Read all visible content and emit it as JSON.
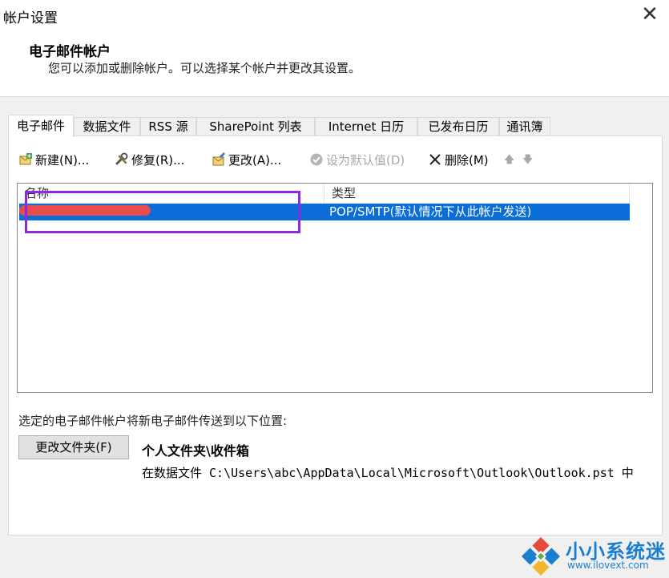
{
  "window": {
    "title": "帐户设置",
    "close_glyph": "✕"
  },
  "header": {
    "title": "电子邮件帐户",
    "description": "您可以添加或删除帐户。可以选择某个帐户并更改其设置。"
  },
  "tabs": [
    {
      "label": "电子邮件",
      "active": true
    },
    {
      "label": "数据文件",
      "active": false
    },
    {
      "label": "RSS 源",
      "active": false
    },
    {
      "label": "SharePoint 列表",
      "active": false
    },
    {
      "label": "Internet 日历",
      "active": false
    },
    {
      "label": "已发布日历",
      "active": false
    },
    {
      "label": "通讯簿",
      "active": false
    }
  ],
  "toolbar": {
    "new_label": "新建(N)...",
    "new_icon": "new-account-icon",
    "repair_label": "修复(R)...",
    "repair_icon": "wrench-icon",
    "change_label": "更改(A)...",
    "change_icon": "change-icon",
    "default_label": "设为默认值(D)",
    "default_icon": "check-circle-icon",
    "delete_label": "删除(M)",
    "delete_icon": "x-icon",
    "up_glyph": "🡅",
    "down_glyph": "🡇"
  },
  "accounts_list": {
    "columns": [
      "名称",
      "类型"
    ],
    "rows": [
      {
        "name": "",
        "type": "POP/SMTP(默认情况下从此帐户发送)",
        "selected": true
      }
    ]
  },
  "delivery": {
    "label": "选定的电子邮件帐户将新电子邮件传送到以下位置:",
    "button_label": "更改文件夹(F)",
    "folder_name": "个人文件夹\\收件箱",
    "folder_path": "在数据文件 C:\\Users\\abc\\AppData\\Local\\Microsoft\\Outlook\\Outlook.pst 中"
  },
  "watermark": {
    "brand": "小小系统迷",
    "url": "www.ilovext.com"
  },
  "colors": {
    "selection": "#0a6dd8",
    "annotation_box": "#8a2be2",
    "redaction": "#ea4c4c",
    "watermark": "#1a7fd1"
  }
}
